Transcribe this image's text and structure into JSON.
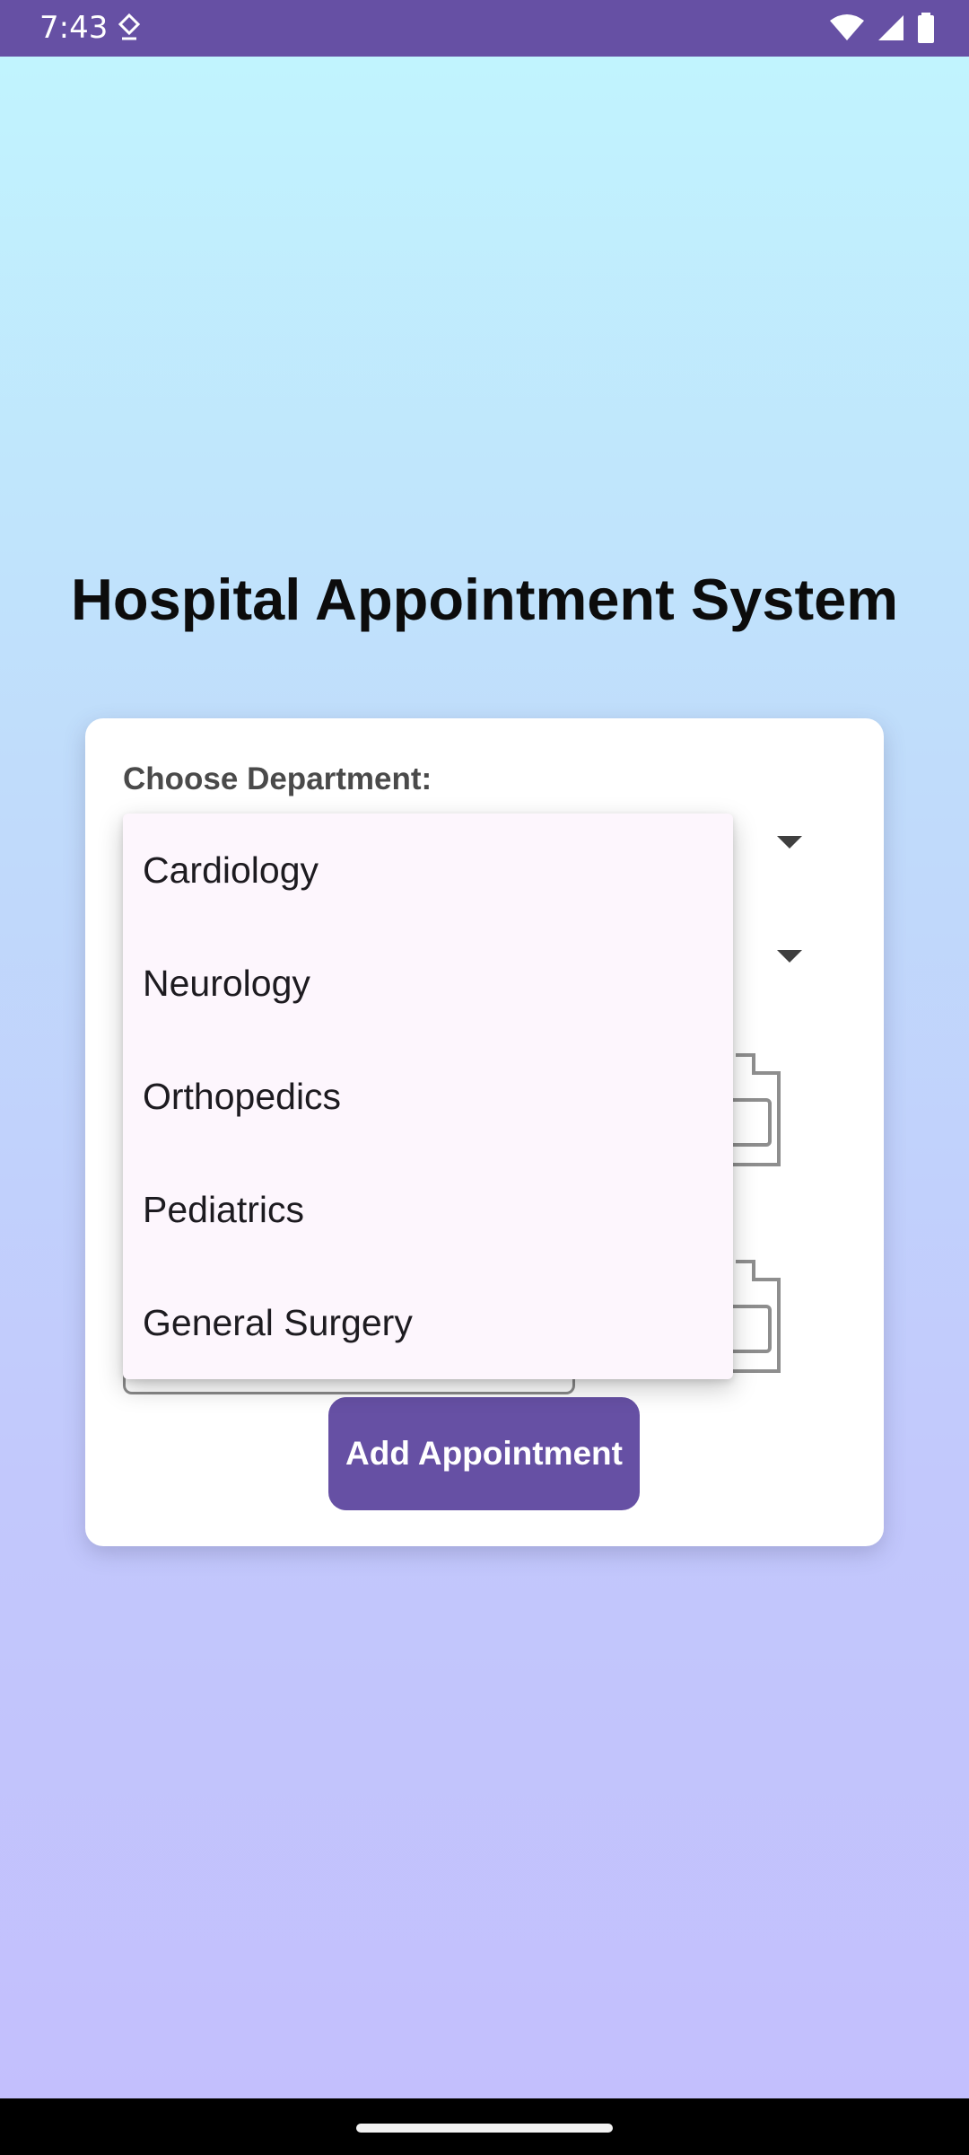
{
  "status_bar": {
    "time": "7:43",
    "icons": [
      "download-icon",
      "wifi-icon",
      "signal-icon",
      "battery-icon"
    ]
  },
  "title": "Hospital Appointment System",
  "form": {
    "department_label": "Choose Department:",
    "add_button_label": "Add Appointment"
  },
  "department_dropdown": {
    "options": [
      "Cardiology",
      "Neurology",
      "Orthopedics",
      "Pediatrics",
      "General Surgery"
    ]
  },
  "colors": {
    "primary": "#6650a4",
    "card": "#ffffff",
    "menu_bg": "#fdf6fd",
    "gradient_top": "#c1f4fe",
    "gradient_bottom": "#c3bffd"
  }
}
